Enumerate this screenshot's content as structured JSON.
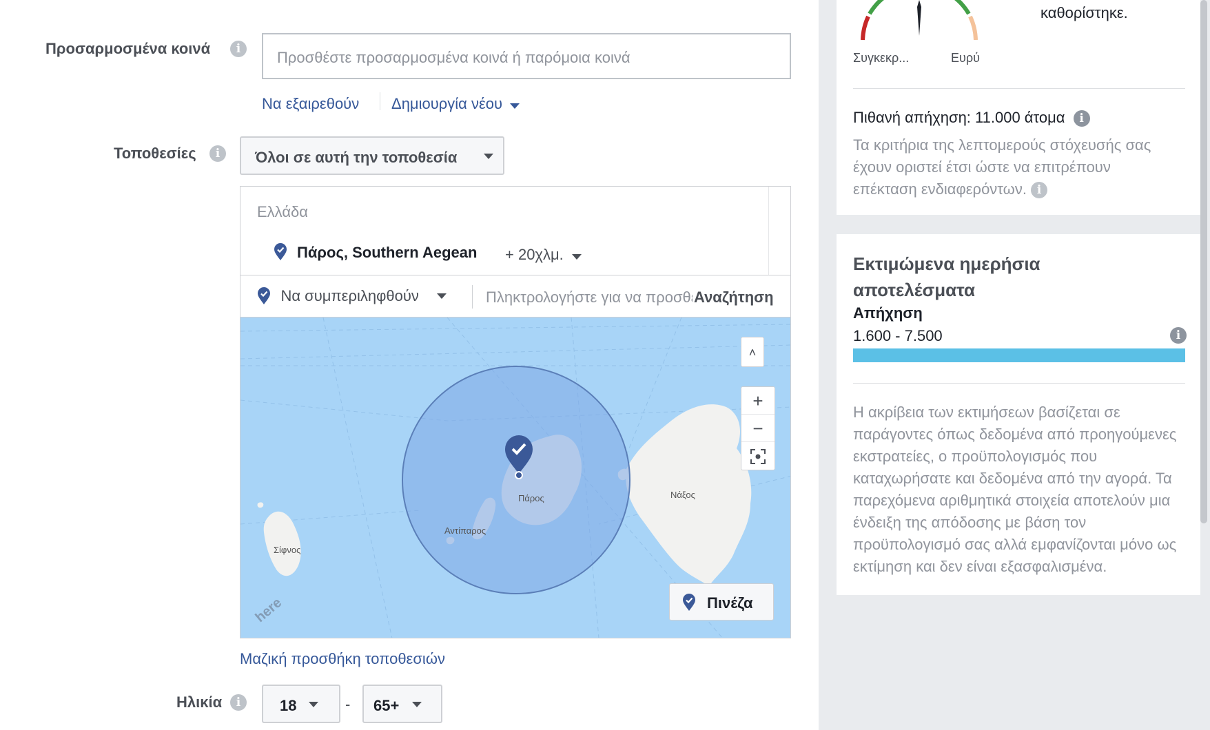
{
  "custom_audiences": {
    "label": "Προσαρμοσμένα κοινά",
    "placeholder": "Προσθέστε προσαρμοσμένα κοινά ή παρόμοια κοινά",
    "exclude_link": "Να εξαιρεθούν",
    "create_new_link": "Δημιουργία νέου"
  },
  "locations": {
    "label": "Τοποθεσίες",
    "type_select": "Όλοι σε αυτή την τοποθεσία",
    "country": "Ελλάδα",
    "selected_location": "Πάρος, Southern Aegean",
    "radius": "+ 20χλμ.",
    "include_select": "Να συμπεριληφθούν",
    "search_placeholder": "Πληκτρολογήστε για να προσθέσετε",
    "search_button": "Αναζήτηση",
    "bulk_add_link": "Μαζική προσθήκη τοποθεσιών"
  },
  "map": {
    "places": [
      "Πάρος",
      "Αντίπαρος",
      "Νάξος",
      "Σίφνος"
    ],
    "drop_pin_button": "Πινέζα",
    "zoom_in": "+",
    "zoom_out": "−",
    "collapse": "˄",
    "watermark": "here",
    "water_color": "#a8d4f7",
    "land_color": "#f2f2f0",
    "radius_fill": "#7da7e6",
    "pin_color": "#3b5998"
  },
  "age": {
    "label": "Ηλικία",
    "min": "18",
    "max": "65+",
    "separator": "-"
  },
  "audience_meter": {
    "label_specific": "Συγκεκρ...",
    "label_broad": "Ευρύ",
    "status_text": "καθορίστηκε.",
    "potential_reach": "Πιθανή απήχηση: 11.000 άτομα",
    "detailed_targeting_note": "Τα κριτήρια της λεπτομερούς στόχευσής σας έχουν οριστεί έτσι ώστε να επιτρέπουν επέκταση ενδιαφερόντων."
  },
  "estimated_results": {
    "title_line1": "Εκτιμώμενα ημερήσια",
    "title_line2": "αποτελέσματα",
    "reach_label": "Απήχηση",
    "reach_range": "1.600 - 7.500",
    "bar_color": "#5bc0e6",
    "disclaimer": "Η ακρίβεια των εκτιμήσεων βασίζεται σε παράγοντες όπως δεδομένα από προηγούμενες εκστρατείες, ο προϋπολογισμός που καταχωρήσατε και δεδομένα από την αγορά. Τα παρεχόμενα αριθμητικά στοιχεία αποτελούν μια ένδειξη της απόδοσης με βάση τον προϋπολογισμό σας αλλά εμφανίζονται μόνο ως εκτίμηση και δεν είναι εξασφαλισμένα."
  }
}
